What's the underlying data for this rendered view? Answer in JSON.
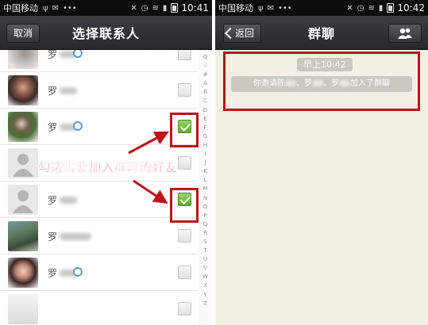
{
  "left_screen": {
    "status_bar": {
      "carrier": "中国移动",
      "time": "10:41"
    },
    "nav": {
      "cancel_label": "取消",
      "title": "选择联系人"
    },
    "contacts": [
      {
        "name": "罗",
        "checked": false
      },
      {
        "name": "罗",
        "checked": false
      },
      {
        "name": "罗",
        "checked": true
      },
      {
        "name": "",
        "checked": false
      },
      {
        "name": "罗",
        "checked": true
      },
      {
        "name": "罗",
        "checked": false
      },
      {
        "name": "罗",
        "checked": false
      }
    ],
    "index_letters": [
      "Q",
      "☆",
      "#",
      "A",
      "B",
      "C",
      "D",
      "E",
      "F",
      "G",
      "H",
      "I",
      "J",
      "K",
      "L",
      "M",
      "N",
      "O",
      "P",
      "Q",
      "R",
      "S",
      "T",
      "U",
      "V",
      "W",
      "X",
      "Y",
      "Z"
    ],
    "annotation": "勾选需要加入群聊的好友"
  },
  "right_screen": {
    "status_bar": {
      "carrier": "中国移动",
      "time": "10:42"
    },
    "nav": {
      "back_label": "返回",
      "title": "群聊"
    },
    "chat": {
      "time_label": "早上10:42",
      "system_msg_prefix": "你邀请陈",
      "system_msg_mid1": "、罗",
      "system_msg_mid2": "、罗",
      "system_msg_suffix": "加入了群聊"
    }
  },
  "colors": {
    "highlight": "#c0121a",
    "check_green": "#6fbb3a",
    "nav_bar": "#2e3033",
    "chat_bg": "#f2f0e4"
  }
}
